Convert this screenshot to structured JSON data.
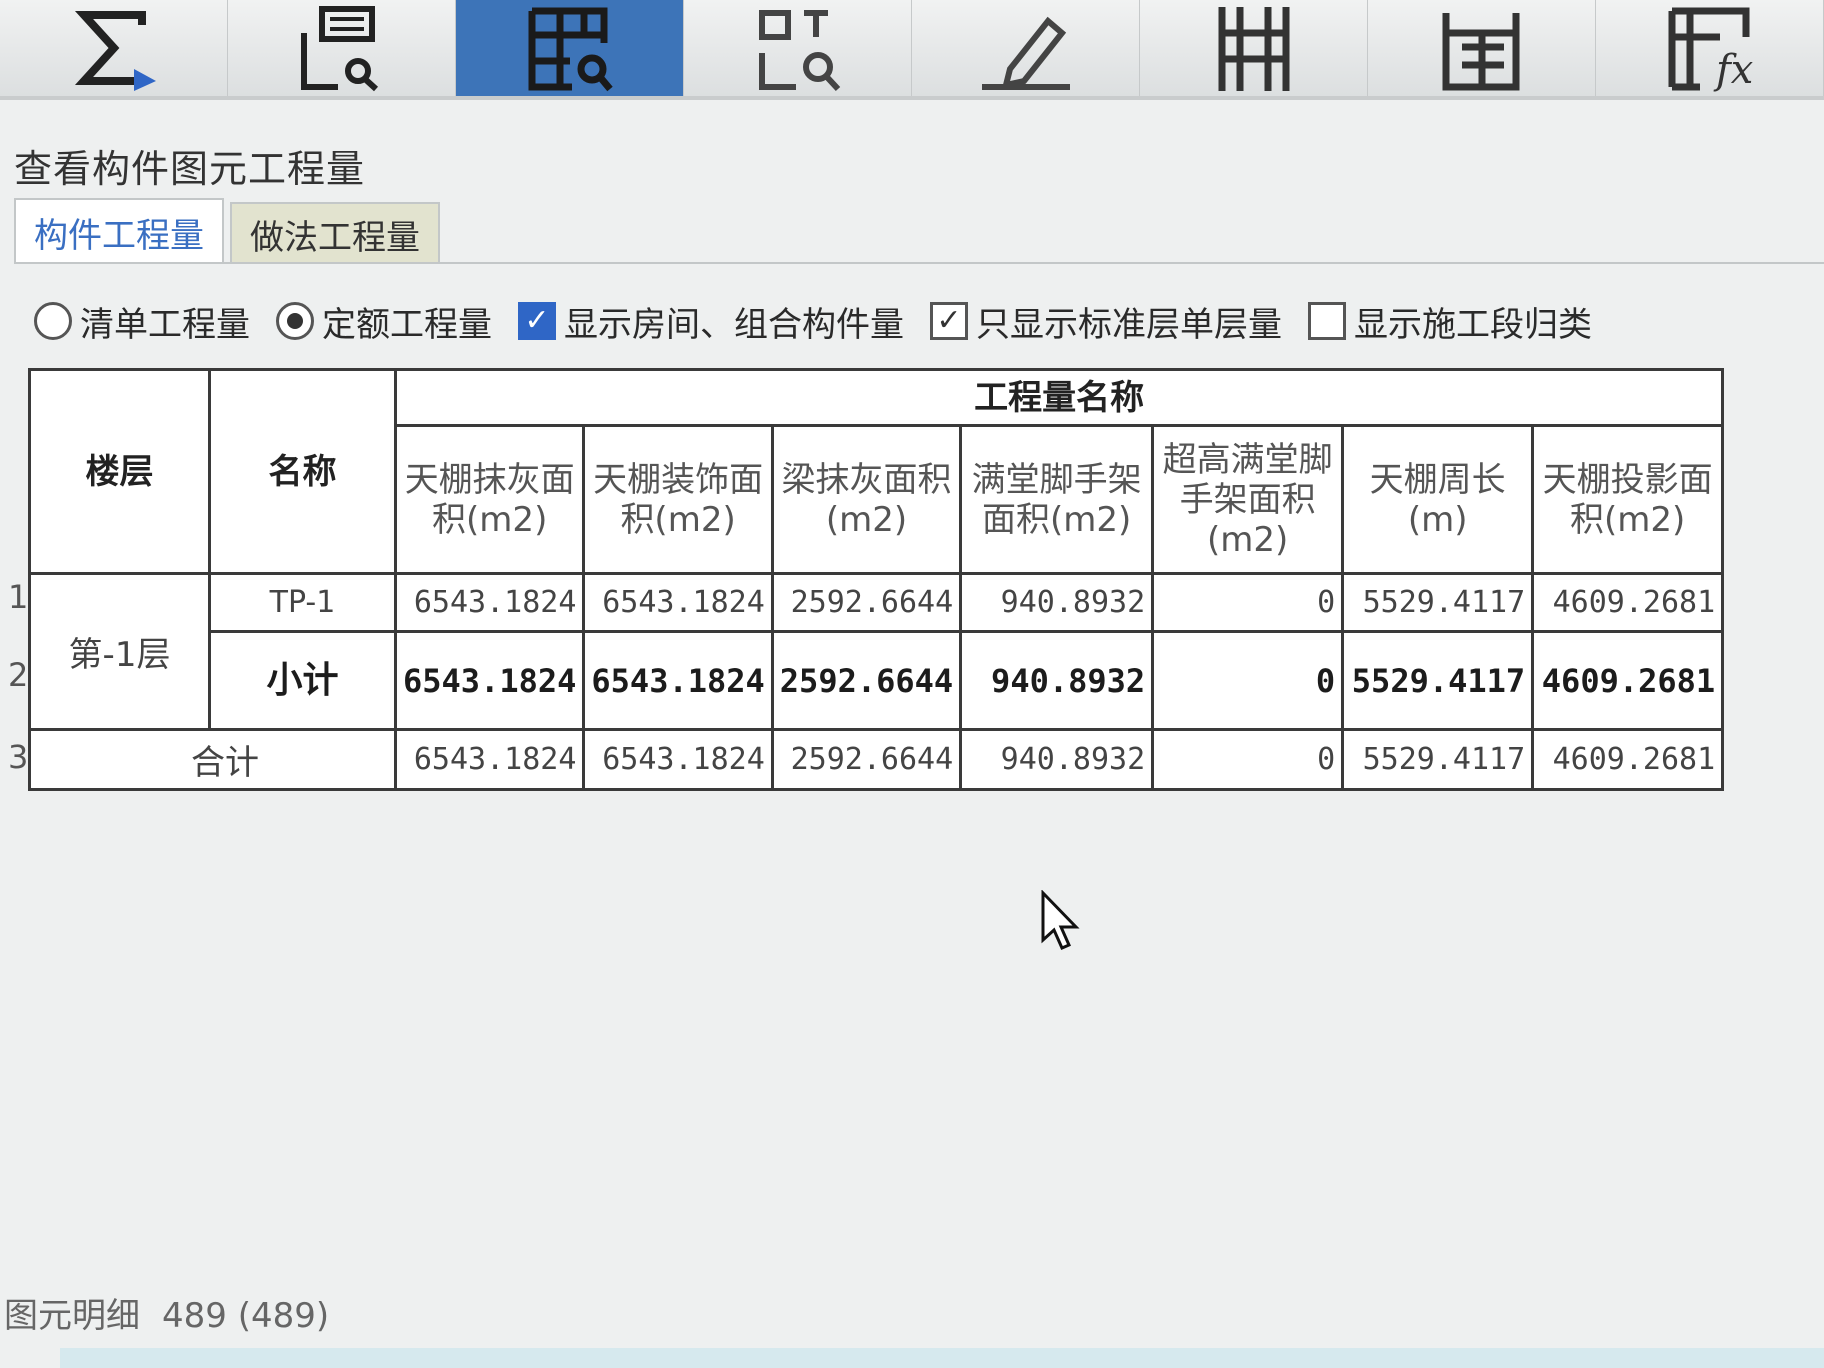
{
  "toolbar": {
    "tools": [
      {
        "icon": "sigma-icon"
      },
      {
        "icon": "view-grid-search-icon"
      },
      {
        "icon": "table-search-icon",
        "active": true
      },
      {
        "icon": "element-search-icon"
      },
      {
        "icon": "pencil-icon"
      },
      {
        "icon": "columns-icon"
      },
      {
        "icon": "calculator-icon"
      },
      {
        "icon": "formula-fx-icon"
      }
    ]
  },
  "panel": {
    "title": "查看构件图元工程量",
    "tabs": [
      {
        "label": "构件工程量",
        "active": true
      },
      {
        "label": "做法工程量",
        "active": false
      }
    ]
  },
  "options": {
    "radio_bill": "清单工程量",
    "radio_quota": "定额工程量",
    "check_room": "显示房间、组合构件量",
    "check_standard": "只显示标准层单层量",
    "check_stage": "显示施工段归类"
  },
  "table": {
    "header_floor": "楼层",
    "header_name": "名称",
    "header_group": "工程量名称",
    "columns": [
      "天棚抹灰面积(m2)",
      "天棚装饰面积(m2)",
      "梁抹灰面积(m2)",
      "满堂脚手架面积(m2)",
      "超高满堂脚手架面积(m2)",
      "天棚周长(m)",
      "天棚投影面积(m2)"
    ],
    "rows": [
      {
        "num": "1",
        "floor": "第-1层",
        "name": "TP-1",
        "values": [
          "6543.1824",
          "6543.1824",
          "2592.6644",
          "940.8932",
          "0",
          "5529.4117",
          "4609.2681"
        ]
      },
      {
        "num": "2",
        "name": "小计",
        "values": [
          "6543.1824",
          "6543.1824",
          "2592.6644",
          "940.8932",
          "0",
          "5529.4117",
          "4609.2681"
        ]
      },
      {
        "num": "3",
        "name": "合计",
        "values": [
          "6543.1824",
          "6543.1824",
          "2592.6644",
          "940.8932",
          "0",
          "5529.4117",
          "4609.2681"
        ]
      }
    ]
  },
  "footer": {
    "label": "图元明细",
    "count": "489 (489)"
  }
}
